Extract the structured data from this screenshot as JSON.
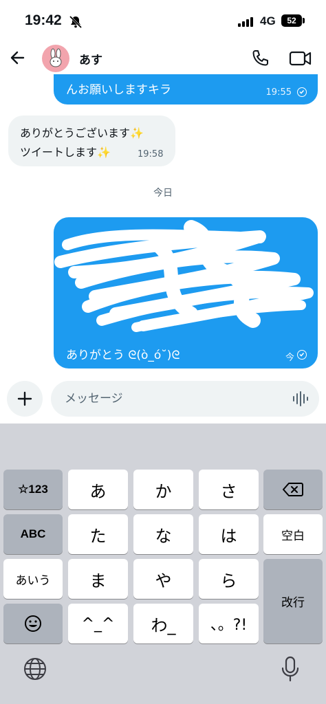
{
  "status_bar": {
    "time": "19:42",
    "network": "4G",
    "battery": "52"
  },
  "header": {
    "contact_name": "あす"
  },
  "messages": [
    {
      "direction": "out",
      "text": "んお願いしますキラ",
      "time": "19:55"
    },
    {
      "direction": "in",
      "line1": "ありがとうございます✨",
      "line2": "ツイートします✨",
      "time": "19:58"
    },
    {
      "direction": "out",
      "last_line": "ありがとう ᘓ(ò_ó˘)ᘓ",
      "time": "今"
    }
  ],
  "date_separator": "今日",
  "composer": {
    "placeholder": "メッセージ"
  },
  "keyboard": {
    "row1": [
      "☆123",
      "あ",
      "か",
      "さ"
    ],
    "row2": [
      "ABC",
      "た",
      "な",
      "は",
      "空白"
    ],
    "row3": [
      "あいう",
      "ま",
      "や",
      "ら",
      "改行"
    ],
    "row4": [
      "^_^",
      "わ_",
      "、。?!"
    ]
  },
  "colors": {
    "accent": "#1d9bf0",
    "incoming_bubble": "#eff3f4",
    "keyboard_bg": "#d1d3d9",
    "key_func": "#adb3bc"
  }
}
